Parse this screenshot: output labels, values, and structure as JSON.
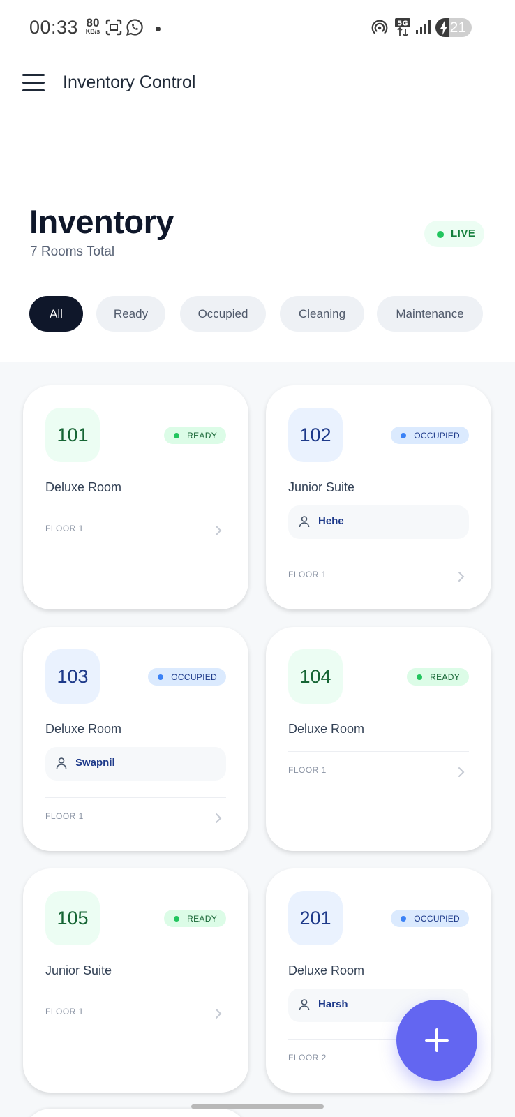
{
  "status_bar": {
    "time": "00:33",
    "net_speed_value": "80",
    "net_speed_unit": "KB/s",
    "battery_percent": "21",
    "battery_level": 0.21
  },
  "app_bar": {
    "title": "Inventory Control"
  },
  "header": {
    "title": "Inventory",
    "subtitle": "7 Rooms Total",
    "live_label": "LIVE"
  },
  "filters": [
    {
      "label": "All",
      "active": true
    },
    {
      "label": "Ready",
      "active": false
    },
    {
      "label": "Occupied",
      "active": false
    },
    {
      "label": "Cleaning",
      "active": false
    },
    {
      "label": "Maintenance",
      "active": false
    }
  ],
  "rooms": [
    {
      "number": "101",
      "status": "READY",
      "type": "Deluxe Room",
      "guest": "",
      "floor": "FLOOR 1"
    },
    {
      "number": "102",
      "status": "OCCUPIED",
      "type": "Junior Suite",
      "guest": "Hehe",
      "floor": "FLOOR 1"
    },
    {
      "number": "103",
      "status": "OCCUPIED",
      "type": "Deluxe Room",
      "guest": "Swapnil",
      "floor": "FLOOR 1"
    },
    {
      "number": "104",
      "status": "READY",
      "type": "Deluxe Room",
      "guest": "",
      "floor": "FLOOR 1"
    },
    {
      "number": "105",
      "status": "READY",
      "type": "Junior Suite",
      "guest": "",
      "floor": "FLOOR 1"
    },
    {
      "number": "201",
      "status": "OCCUPIED",
      "type": "Deluxe Room",
      "guest": "Harsh",
      "floor": "FLOOR 2"
    }
  ],
  "icons": {
    "menu": "hamburger-menu-icon",
    "guest": "person-icon",
    "chevron": "chevron-right-icon",
    "fab": "plus-icon"
  },
  "colors": {
    "accent": "#6366f1",
    "ready": "#22c55e",
    "occupied": "#3b82f6",
    "dark": "#0f172a"
  }
}
